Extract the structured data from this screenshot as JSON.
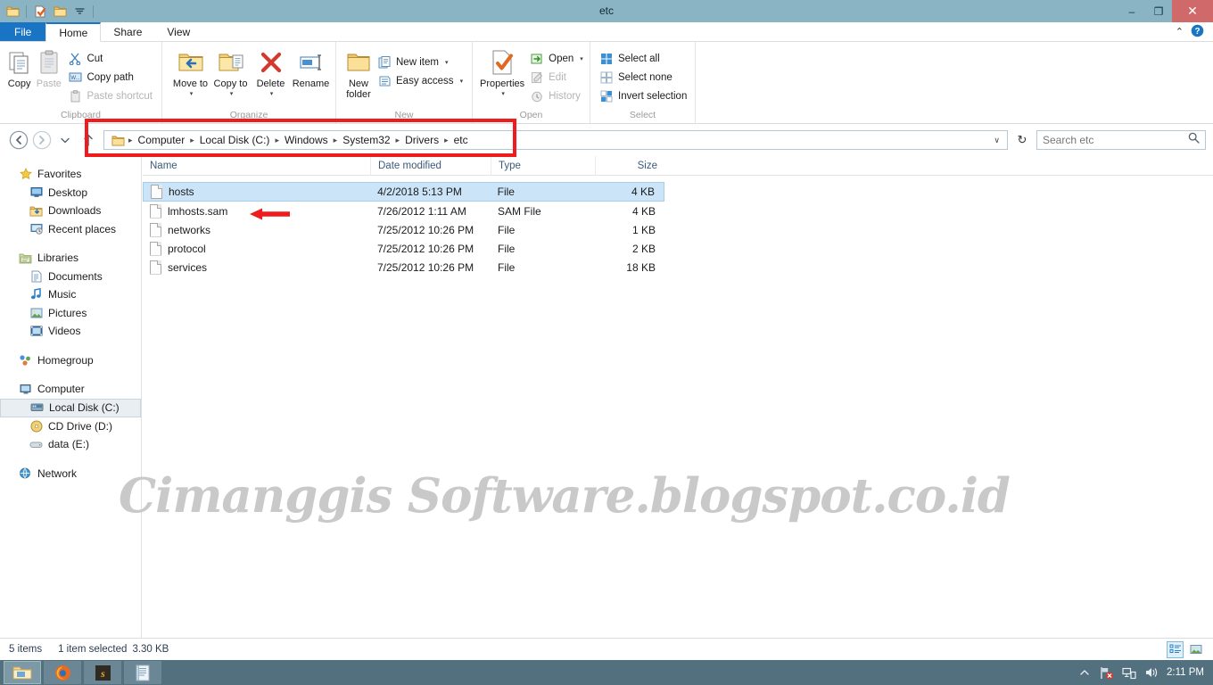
{
  "window": {
    "title": "etc",
    "minimize_label": "–",
    "restore_label": "❐",
    "close_label": "✕"
  },
  "quick_access": [
    {
      "name": "folder-icon",
      "label": "Folder"
    },
    {
      "name": "properties-icon",
      "label": "Properties"
    },
    {
      "name": "new-folder-icon",
      "label": "New folder"
    },
    {
      "name": "customize-icon",
      "label": "Customize Quick Access Toolbar"
    }
  ],
  "tabs": [
    {
      "label": "File",
      "id": "file"
    },
    {
      "label": "Home",
      "id": "home"
    },
    {
      "label": "Share",
      "id": "share"
    },
    {
      "label": "View",
      "id": "view"
    }
  ],
  "tabstrip_right": {
    "collapse_label": "⌃",
    "help_label": "?"
  },
  "ribbon": {
    "groups": [
      {
        "id": "clipboard",
        "label": "Clipboard",
        "big": [
          {
            "label": "Copy",
            "icon": "copy-icon",
            "disabled": false
          },
          {
            "label": "Paste",
            "icon": "paste-icon",
            "disabled": true
          }
        ],
        "small": [
          {
            "label": "Cut",
            "icon": "cut-icon",
            "disabled": false
          },
          {
            "label": "Copy path",
            "icon": "copy-path-icon",
            "disabled": false
          },
          {
            "label": "Paste shortcut",
            "icon": "paste-shortcut-icon",
            "disabled": true
          }
        ]
      },
      {
        "id": "organize",
        "label": "Organize",
        "big": [
          {
            "label": "Move to",
            "icon": "move-to-icon",
            "caret": true
          },
          {
            "label": "Copy to",
            "icon": "copy-to-icon",
            "caret": true
          },
          {
            "label": "Delete",
            "icon": "delete-icon",
            "caret": true
          },
          {
            "label": "Rename",
            "icon": "rename-icon",
            "caret": false
          }
        ]
      },
      {
        "id": "new",
        "label": "New",
        "big": [
          {
            "label": "New folder",
            "icon": "new-folder-icon",
            "caret": false
          }
        ],
        "small": [
          {
            "label": "New item",
            "icon": "new-item-icon",
            "caret": true
          },
          {
            "label": "Easy access",
            "icon": "easy-access-icon",
            "caret": true
          }
        ]
      },
      {
        "id": "open",
        "label": "Open",
        "big": [
          {
            "label": "Properties",
            "icon": "properties-icon",
            "caret": true
          }
        ],
        "small": [
          {
            "label": "Open",
            "icon": "open-icon",
            "caret": true,
            "disabled": false
          },
          {
            "label": "Edit",
            "icon": "edit-icon",
            "disabled": true
          },
          {
            "label": "History",
            "icon": "history-icon",
            "disabled": true
          }
        ]
      },
      {
        "id": "select",
        "label": "Select",
        "small": [
          {
            "label": "Select all",
            "icon": "select-all-icon"
          },
          {
            "label": "Select none",
            "icon": "select-none-icon"
          },
          {
            "label": "Invert selection",
            "icon": "invert-selection-icon"
          }
        ]
      }
    ]
  },
  "address": {
    "back_label": "Back",
    "forward_label": "Forward",
    "recent_label": "Recent locations",
    "up_label": "Up",
    "crumbs": [
      "Computer",
      "Local Disk (C:)",
      "Windows",
      "System32",
      "Drivers",
      "etc"
    ],
    "separator": "▸",
    "dropdown_label": "∨",
    "refresh_label": "↻"
  },
  "search": {
    "placeholder": "Search etc",
    "value": "",
    "icon": "search-icon"
  },
  "navpane": {
    "items": [
      {
        "label": "Favorites",
        "icon": "star-icon",
        "level": "root",
        "selected": false
      },
      {
        "label": "Desktop",
        "icon": "desktop-icon",
        "level": "child",
        "selected": false
      },
      {
        "label": "Downloads",
        "icon": "downloads-icon",
        "level": "child",
        "selected": false
      },
      {
        "label": "Recent places",
        "icon": "recent-places-icon",
        "level": "child",
        "selected": false
      },
      {
        "label": "__SPACER__",
        "icon": "",
        "level": "spacer",
        "selected": false
      },
      {
        "label": "Libraries",
        "icon": "libraries-icon",
        "level": "root",
        "selected": false
      },
      {
        "label": "Documents",
        "icon": "documents-icon",
        "level": "child",
        "selected": false
      },
      {
        "label": "Music",
        "icon": "music-icon",
        "level": "child",
        "selected": false
      },
      {
        "label": "Pictures",
        "icon": "pictures-icon",
        "level": "child",
        "selected": false
      },
      {
        "label": "Videos",
        "icon": "videos-icon",
        "level": "child",
        "selected": false
      },
      {
        "label": "__SPACER__",
        "icon": "",
        "level": "spacer",
        "selected": false
      },
      {
        "label": "Homegroup",
        "icon": "homegroup-icon",
        "level": "root",
        "selected": false
      },
      {
        "label": "__SPACER__",
        "icon": "",
        "level": "spacer",
        "selected": false
      },
      {
        "label": "Computer",
        "icon": "computer-icon",
        "level": "root",
        "selected": false
      },
      {
        "label": "Local Disk (C:)",
        "icon": "hard-drive-icon",
        "level": "child",
        "selected": true
      },
      {
        "label": "CD Drive (D:)",
        "icon": "cd-drive-icon",
        "level": "child",
        "selected": false
      },
      {
        "label": "data (E:)",
        "icon": "removable-drive-icon",
        "level": "child",
        "selected": false
      },
      {
        "label": "__SPACER__",
        "icon": "",
        "level": "spacer",
        "selected": false
      },
      {
        "label": "Network",
        "icon": "network-icon",
        "level": "root",
        "selected": false
      }
    ]
  },
  "filelist": {
    "columns": [
      "Name",
      "Date modified",
      "Type",
      "Size"
    ],
    "rows": [
      {
        "name": "hosts",
        "date": "4/2/2018 5:13 PM",
        "type": "File",
        "size": "4 KB",
        "selected": true,
        "icon": "file-icon"
      },
      {
        "name": "lmhosts.sam",
        "date": "7/26/2012 1:11 AM",
        "type": "SAM File",
        "size": "4 KB",
        "selected": false,
        "icon": "file-icon"
      },
      {
        "name": "networks",
        "date": "7/25/2012 10:26 PM",
        "type": "File",
        "size": "1 KB",
        "selected": false,
        "icon": "file-icon"
      },
      {
        "name": "protocol",
        "date": "7/25/2012 10:26 PM",
        "type": "File",
        "size": "2 KB",
        "selected": false,
        "icon": "file-icon"
      },
      {
        "name": "services",
        "date": "7/25/2012 10:26 PM",
        "type": "File",
        "size": "18 KB",
        "selected": false,
        "icon": "file-icon"
      }
    ]
  },
  "annotations": {
    "address_highlight_color": "#ee1c1c",
    "arrow_color": "#ee1c1c",
    "arrow_name": "red-arrow-pointing-to-hosts"
  },
  "watermark": {
    "text": "Cimanggis Software.blogspot.co.id",
    "color": "#c9c9c9"
  },
  "statusbar": {
    "item_count": "5 items",
    "selection": "1 item selected",
    "selection_size": "3.30 KB",
    "views": [
      {
        "name": "details-view-button",
        "active": true
      },
      {
        "name": "large-icons-view-button",
        "active": false
      }
    ]
  },
  "taskbar": {
    "buttons": [
      {
        "name": "taskbar-file-explorer",
        "label": "File Explorer",
        "active": true
      },
      {
        "name": "taskbar-firefox",
        "label": "Mozilla Firefox",
        "active": false
      },
      {
        "name": "taskbar-sublime-text",
        "label": "Sublime Text",
        "active": false
      },
      {
        "name": "taskbar-notepad",
        "label": "Notepad",
        "active": false
      }
    ],
    "tray": {
      "show_hidden_label": "▲",
      "icons": [
        {
          "name": "network-error-icon",
          "label": "Network (no connection)"
        },
        {
          "name": "action-center-icon",
          "label": "Action Center"
        },
        {
          "name": "volume-icon",
          "label": "Volume"
        }
      ],
      "clock": "2:11 PM"
    }
  },
  "colors": {
    "titlebar": "#8ab4c4",
    "accent": "#1a74c4",
    "selection": "#cce4f7",
    "taskbar": "#52707d",
    "close_button": "#d06a6a"
  }
}
